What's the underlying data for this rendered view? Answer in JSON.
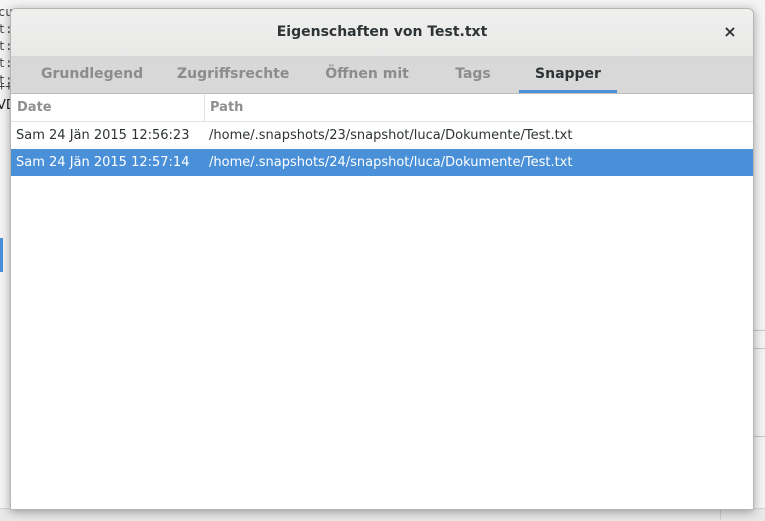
{
  "background": {
    "text_lines": [
      "cu",
      "t:",
      "t:",
      "t:",
      "t:",
      "++"
    ],
    "fragment": "VD"
  },
  "dialog": {
    "title": "Eigenschaften von Test.txt",
    "close_glyph": "×",
    "tabs": [
      {
        "label": "Grundlegend",
        "active": false
      },
      {
        "label": "Zugriffsrechte",
        "active": false
      },
      {
        "label": "Öffnen mit",
        "active": false
      },
      {
        "label": "Tags",
        "active": false
      },
      {
        "label": "Snapper",
        "active": true
      }
    ],
    "table": {
      "columns": [
        "Date",
        "Path"
      ],
      "rows": [
        {
          "date": "Sam 24 Jän 2015 12:56:23",
          "path": "/home/.snapshots/23/snapshot/luca/Dokumente/Test.txt",
          "selected": false
        },
        {
          "date": "Sam 24 Jän 2015 12:57:14",
          "path": "/home/.snapshots/24/snapshot/luca/Dokumente/Test.txt",
          "selected": true
        }
      ]
    }
  },
  "colors": {
    "accent": "#4a90d9",
    "title_text": "#2e3436",
    "tab_inactive": "#8c8c8c"
  }
}
